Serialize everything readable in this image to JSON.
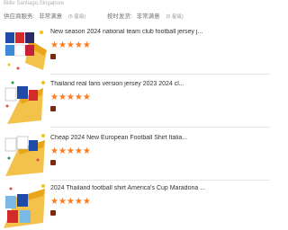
{
  "header": {
    "reviewer": "Billie Santiago,Singapore",
    "rating_groups": [
      {
        "label": "供应商服务:",
        "value": "非常满意",
        "count": "(5 星级)"
      },
      {
        "label": "按时发货:",
        "value": "非常满意",
        "count": "(5 星级)"
      }
    ]
  },
  "items": [
    {
      "title": "New season 2024 national team club football jersey j...",
      "stars": "★★★★★",
      "rating": 5
    },
    {
      "title": "Thailand real fans version jersey 2023 2024 cl...",
      "stars": "★★★★★",
      "rating": 5
    },
    {
      "title": "Cheap 2024 New European Football Shirt Italia...",
      "stars": "★★★★★",
      "rating": 5
    },
    {
      "title": "2024 Thailand football shirt America's Cup Maradona ...",
      "stars": "★★★★★",
      "rating": 5
    }
  ],
  "colors": {
    "star": "#ff7a1a",
    "seller_mark": "#7a2a12"
  }
}
